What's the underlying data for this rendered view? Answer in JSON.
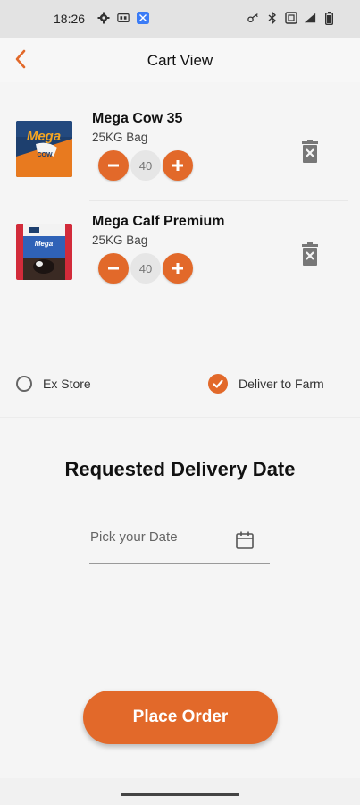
{
  "status_bar": {
    "time": "18:26",
    "left_icons": [
      "gear-icon",
      "sim-icon",
      "app-notification-icon"
    ],
    "right_icons": [
      "key-icon",
      "bluetooth-icon",
      "nfc-icon",
      "signal-icon",
      "battery-icon"
    ],
    "colors": {
      "app_icon": "#3b7cf6"
    }
  },
  "header": {
    "title": "Cart View",
    "back_icon": "chevron-left-icon"
  },
  "cart": {
    "items": [
      {
        "name": "Mega Cow 35",
        "pack": "25KG Bag",
        "quantity": "40",
        "image_icon": "mega-cow-bag-image",
        "image_text": "Mega"
      },
      {
        "name": "Mega Calf Premium",
        "pack": "25KG Bag",
        "quantity": "40",
        "image_icon": "mega-calf-bag-image",
        "image_text": "Mega"
      }
    ]
  },
  "delivery_options": {
    "ex_store": {
      "label": "Ex Store",
      "selected": false
    },
    "deliver_to_farm": {
      "label": "Deliver to Farm",
      "selected": true
    }
  },
  "delivery_date": {
    "title": "Requested Delivery Date",
    "placeholder": "Pick your Date",
    "icon": "calendar-icon"
  },
  "actions": {
    "place_order": "Place Order"
  },
  "theme": {
    "accent": "#e2692a",
    "background": "#f5f5f5",
    "status_bar": "#e3e3e3"
  }
}
